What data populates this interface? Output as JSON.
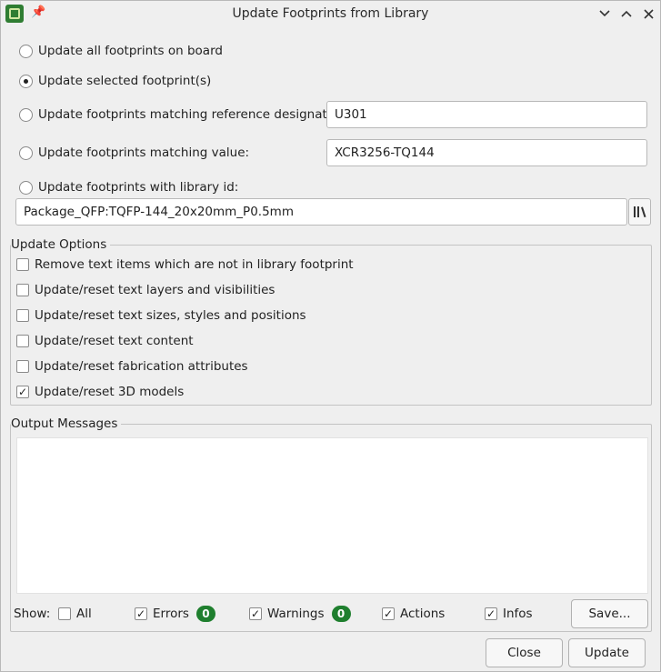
{
  "window": {
    "title": "Update Footprints from Library",
    "icons": {
      "app": "kicad-pcb-icon",
      "pin": "pin-icon",
      "minimize": "chevron-down-icon",
      "maximize": "chevron-up-icon",
      "close": "close-icon"
    }
  },
  "scope": {
    "all": "Update all footprints on board",
    "selected": "Update selected footprint(s)",
    "by_ref": "Update footprints matching reference designator:",
    "by_value": "Update footprints matching value:",
    "by_libid": "Update footprints with library id:",
    "selected_option": "selected",
    "ref_value": "U301",
    "value_value": "XCR3256-TQ144",
    "libid_value": "Package_QFP:TQFP-144_20x20mm_P0.5mm"
  },
  "update_options": {
    "title": "Update Options",
    "items": [
      {
        "label": "Remove text items which are not in library footprint",
        "checked": false
      },
      {
        "label": "Update/reset text layers and visibilities",
        "checked": false
      },
      {
        "label": "Update/reset text sizes, styles and positions",
        "checked": false
      },
      {
        "label": "Update/reset text content",
        "checked": false
      },
      {
        "label": "Update/reset fabrication attributes",
        "checked": false
      },
      {
        "label": "Update/reset 3D models",
        "checked": true
      }
    ]
  },
  "output": {
    "title": "Output Messages",
    "show_label": "Show:",
    "filters": {
      "all": {
        "label": "All",
        "checked": false
      },
      "errors": {
        "label": "Errors",
        "checked": true,
        "count": "0"
      },
      "warnings": {
        "label": "Warnings",
        "checked": true,
        "count": "0"
      },
      "actions": {
        "label": "Actions",
        "checked": true
      },
      "infos": {
        "label": "Infos",
        "checked": true
      }
    },
    "save_label": "Save..."
  },
  "buttons": {
    "close": "Close",
    "update": "Update"
  },
  "colors": {
    "badge": "#1f7f2e",
    "background": "#efefef"
  }
}
